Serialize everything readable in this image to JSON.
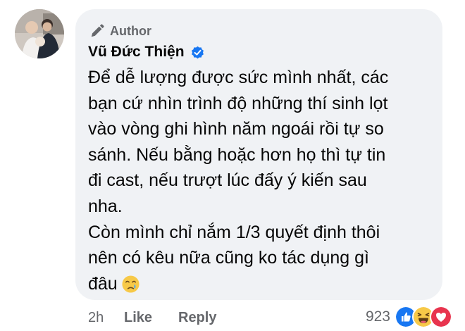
{
  "comment": {
    "badge": "Author",
    "author_name": "Vũ Đức Thiện",
    "text_lines": [
      "Để dễ lượng được sức mình nhất, các",
      "bạn cứ nhìn trình độ những thí sinh lọt",
      "vào vòng ghi hình năm ngoái rồi tự so",
      "sánh. Nếu bằng hoặc hơn họ thì tự tin",
      "đi cast, nếu trượt lúc đấy ý kiến sau",
      "nha.",
      "Còn mình chỉ nắm 1/3 quyết định thôi",
      "nên có kêu nữa cũng ko tác dụng gì",
      "đâu"
    ],
    "trailing_emoji": "crying-face-emoji",
    "bubble_color": "#f0f2f5",
    "verified_color": "#1877f2"
  },
  "actions": {
    "time": "2h",
    "like_label": "Like",
    "reply_label": "Reply"
  },
  "reactions": {
    "count": "923",
    "types": [
      "like",
      "haha",
      "love"
    ]
  }
}
